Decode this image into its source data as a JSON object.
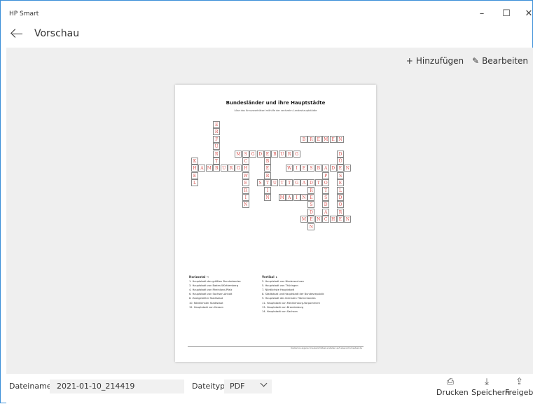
{
  "window": {
    "app_title": "HP Smart",
    "minimize": "–",
    "maximize": "☐",
    "close": "✕"
  },
  "header": {
    "back_icon": "back-arrow-icon",
    "title": "Vorschau"
  },
  "toolbar": {
    "add": {
      "icon": "+",
      "label": "Hinzufügen"
    },
    "edit": {
      "icon": "✎",
      "label": "Bearbeiten"
    }
  },
  "document": {
    "title": "Bundesländer und ihre Hauptstädte",
    "subtitle": "Löse das Kreuzworträtsel mithilfe der sechzehn Landeshauptstädte",
    "horizontal_heading": "Horizontal →",
    "horizontal_clues": [
      "1. Hauptstadt des größten Bundeslandes",
      "3. Hauptstadt von Baden-Württemberg",
      "4. Hauptstadt von Rheinland-Pfalz",
      "6. Hauptstadt von Sachsen-Anhalt",
      "8. Zweigeteilter Stadtstaat",
      "10. Nördlichster Stadtstaat",
      "12. Hauptstadt von Hessen"
    ],
    "vertical_heading": "Vertikal ↓",
    "vertical_clues": [
      "2. Hauptstadt von Niedersachsen",
      "5. Hauptstadt von Thüringen",
      "7. Nördlichste Hauptstadt",
      "8. Stadtstaat und Hauptstadt der Bundesrepublik",
      "9. Hauptstadt des kleinsten Flächenlandes",
      "11. Hauptstadt von Mecklenburg-Vorpommern",
      "13. Hauptstadt von Brandenburg",
      "14. Hauptstadt von Sachsen"
    ],
    "footer_credit": "Kostenlos eigene Kreuzworträtsel erstellen auf www.schulraetsel.de",
    "words": [
      {
        "word": "ERFURT",
        "dir": "v",
        "col": 3,
        "row": 0
      },
      {
        "word": "BREMEN",
        "dir": "h",
        "col": 15,
        "row": 2
      },
      {
        "word": "MAGDEBURG",
        "dir": "h",
        "col": 6,
        "row": 4
      },
      {
        "word": "DÜSSELDORF",
        "dir": "v",
        "col": 20,
        "row": 4
      },
      {
        "word": "KIEL",
        "dir": "v",
        "col": 0,
        "row": 5
      },
      {
        "word": "HAMBURG",
        "dir": "h",
        "col": 0,
        "row": 6
      },
      {
        "word": "WIESBADEN",
        "dir": "h",
        "col": 13,
        "row": 6
      },
      {
        "word": "SCHWERIN",
        "dir": "v",
        "col": 7,
        "row": 4
      },
      {
        "word": "BERLIN",
        "dir": "v",
        "col": 10,
        "row": 5
      },
      {
        "word": "STUTTGART",
        "dir": "h",
        "col": 9,
        "row": 8
      },
      {
        "word": "POTSDAM",
        "dir": "v",
        "col": 18,
        "row": 7
      },
      {
        "word": "MAINZ",
        "dir": "h",
        "col": 12,
        "row": 10
      },
      {
        "word": "MÜNCHEN",
        "dir": "h",
        "col": 15,
        "row": 13
      },
      {
        "word": "DRESDEN",
        "dir": "v",
        "col": 16,
        "row": 8
      }
    ]
  },
  "bottom": {
    "filename_label": "Dateiname:",
    "filename_value": "2021-01-10_214419",
    "filetype_label": "Dateityp",
    "filetype_value": "PDF",
    "print": {
      "icon": "⎙",
      "label": "Drucken"
    },
    "save": {
      "icon": "⤓",
      "label": "Speichern"
    },
    "share": {
      "icon": "⇪",
      "label": "Freigeben"
    }
  }
}
